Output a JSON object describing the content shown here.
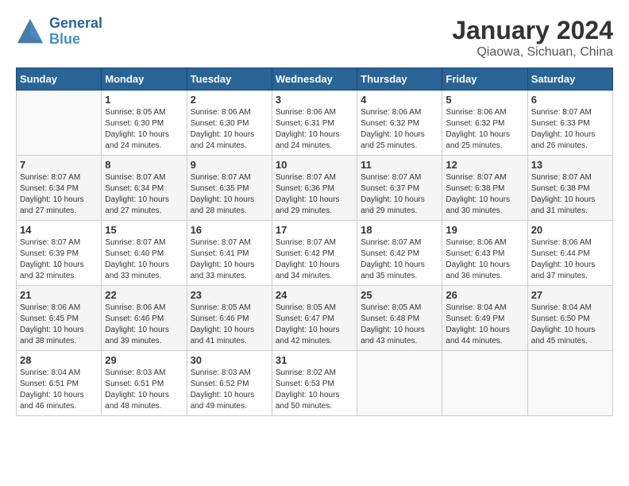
{
  "logo": {
    "line1": "General",
    "line2": "Blue"
  },
  "title": "January 2024",
  "subtitle": "Qiaowa, Sichuan, China",
  "headers": [
    "Sunday",
    "Monday",
    "Tuesday",
    "Wednesday",
    "Thursday",
    "Friday",
    "Saturday"
  ],
  "weeks": [
    [
      {
        "day": "",
        "sunrise": "",
        "sunset": "",
        "daylight": ""
      },
      {
        "day": "1",
        "sunrise": "Sunrise: 8:05 AM",
        "sunset": "Sunset: 6:30 PM",
        "daylight": "Daylight: 10 hours and 24 minutes."
      },
      {
        "day": "2",
        "sunrise": "Sunrise: 8:06 AM",
        "sunset": "Sunset: 6:30 PM",
        "daylight": "Daylight: 10 hours and 24 minutes."
      },
      {
        "day": "3",
        "sunrise": "Sunrise: 8:06 AM",
        "sunset": "Sunset: 6:31 PM",
        "daylight": "Daylight: 10 hours and 24 minutes."
      },
      {
        "day": "4",
        "sunrise": "Sunrise: 8:06 AM",
        "sunset": "Sunset: 6:32 PM",
        "daylight": "Daylight: 10 hours and 25 minutes."
      },
      {
        "day": "5",
        "sunrise": "Sunrise: 8:06 AM",
        "sunset": "Sunset: 6:32 PM",
        "daylight": "Daylight: 10 hours and 25 minutes."
      },
      {
        "day": "6",
        "sunrise": "Sunrise: 8:07 AM",
        "sunset": "Sunset: 6:33 PM",
        "daylight": "Daylight: 10 hours and 26 minutes."
      }
    ],
    [
      {
        "day": "7",
        "sunrise": "Sunrise: 8:07 AM",
        "sunset": "Sunset: 6:34 PM",
        "daylight": "Daylight: 10 hours and 27 minutes."
      },
      {
        "day": "8",
        "sunrise": "Sunrise: 8:07 AM",
        "sunset": "Sunset: 6:34 PM",
        "daylight": "Daylight: 10 hours and 27 minutes."
      },
      {
        "day": "9",
        "sunrise": "Sunrise: 8:07 AM",
        "sunset": "Sunset: 6:35 PM",
        "daylight": "Daylight: 10 hours and 28 minutes."
      },
      {
        "day": "10",
        "sunrise": "Sunrise: 8:07 AM",
        "sunset": "Sunset: 6:36 PM",
        "daylight": "Daylight: 10 hours and 29 minutes."
      },
      {
        "day": "11",
        "sunrise": "Sunrise: 8:07 AM",
        "sunset": "Sunset: 6:37 PM",
        "daylight": "Daylight: 10 hours and 29 minutes."
      },
      {
        "day": "12",
        "sunrise": "Sunrise: 8:07 AM",
        "sunset": "Sunset: 6:38 PM",
        "daylight": "Daylight: 10 hours and 30 minutes."
      },
      {
        "day": "13",
        "sunrise": "Sunrise: 8:07 AM",
        "sunset": "Sunset: 6:38 PM",
        "daylight": "Daylight: 10 hours and 31 minutes."
      }
    ],
    [
      {
        "day": "14",
        "sunrise": "Sunrise: 8:07 AM",
        "sunset": "Sunset: 6:39 PM",
        "daylight": "Daylight: 10 hours and 32 minutes."
      },
      {
        "day": "15",
        "sunrise": "Sunrise: 8:07 AM",
        "sunset": "Sunset: 6:40 PM",
        "daylight": "Daylight: 10 hours and 33 minutes."
      },
      {
        "day": "16",
        "sunrise": "Sunrise: 8:07 AM",
        "sunset": "Sunset: 6:41 PM",
        "daylight": "Daylight: 10 hours and 33 minutes."
      },
      {
        "day": "17",
        "sunrise": "Sunrise: 8:07 AM",
        "sunset": "Sunset: 6:42 PM",
        "daylight": "Daylight: 10 hours and 34 minutes."
      },
      {
        "day": "18",
        "sunrise": "Sunrise: 8:07 AM",
        "sunset": "Sunset: 6:42 PM",
        "daylight": "Daylight: 10 hours and 35 minutes."
      },
      {
        "day": "19",
        "sunrise": "Sunrise: 8:06 AM",
        "sunset": "Sunset: 6:43 PM",
        "daylight": "Daylight: 10 hours and 36 minutes."
      },
      {
        "day": "20",
        "sunrise": "Sunrise: 8:06 AM",
        "sunset": "Sunset: 6:44 PM",
        "daylight": "Daylight: 10 hours and 37 minutes."
      }
    ],
    [
      {
        "day": "21",
        "sunrise": "Sunrise: 8:06 AM",
        "sunset": "Sunset: 6:45 PM",
        "daylight": "Daylight: 10 hours and 38 minutes."
      },
      {
        "day": "22",
        "sunrise": "Sunrise: 8:06 AM",
        "sunset": "Sunset: 6:46 PM",
        "daylight": "Daylight: 10 hours and 39 minutes."
      },
      {
        "day": "23",
        "sunrise": "Sunrise: 8:05 AM",
        "sunset": "Sunset: 6:46 PM",
        "daylight": "Daylight: 10 hours and 41 minutes."
      },
      {
        "day": "24",
        "sunrise": "Sunrise: 8:05 AM",
        "sunset": "Sunset: 6:47 PM",
        "daylight": "Daylight: 10 hours and 42 minutes."
      },
      {
        "day": "25",
        "sunrise": "Sunrise: 8:05 AM",
        "sunset": "Sunset: 6:48 PM",
        "daylight": "Daylight: 10 hours and 43 minutes."
      },
      {
        "day": "26",
        "sunrise": "Sunrise: 8:04 AM",
        "sunset": "Sunset: 6:49 PM",
        "daylight": "Daylight: 10 hours and 44 minutes."
      },
      {
        "day": "27",
        "sunrise": "Sunrise: 8:04 AM",
        "sunset": "Sunset: 6:50 PM",
        "daylight": "Daylight: 10 hours and 45 minutes."
      }
    ],
    [
      {
        "day": "28",
        "sunrise": "Sunrise: 8:04 AM",
        "sunset": "Sunset: 6:51 PM",
        "daylight": "Daylight: 10 hours and 46 minutes."
      },
      {
        "day": "29",
        "sunrise": "Sunrise: 8:03 AM",
        "sunset": "Sunset: 6:51 PM",
        "daylight": "Daylight: 10 hours and 48 minutes."
      },
      {
        "day": "30",
        "sunrise": "Sunrise: 8:03 AM",
        "sunset": "Sunset: 6:52 PM",
        "daylight": "Daylight: 10 hours and 49 minutes."
      },
      {
        "day": "31",
        "sunrise": "Sunrise: 8:02 AM",
        "sunset": "Sunset: 6:53 PM",
        "daylight": "Daylight: 10 hours and 50 minutes."
      },
      {
        "day": "",
        "sunrise": "",
        "sunset": "",
        "daylight": ""
      },
      {
        "day": "",
        "sunrise": "",
        "sunset": "",
        "daylight": ""
      },
      {
        "day": "",
        "sunrise": "",
        "sunset": "",
        "daylight": ""
      }
    ]
  ]
}
